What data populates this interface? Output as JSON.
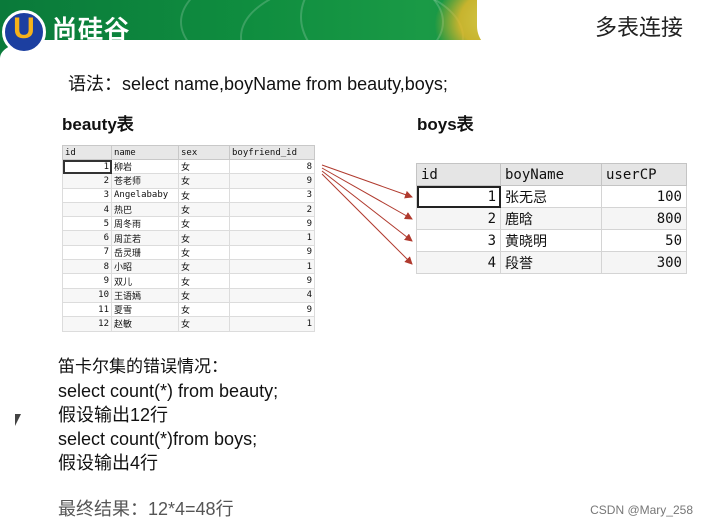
{
  "header": {
    "logo_text": "尚硅谷",
    "logo_url": "www.atguigu.com",
    "title": "多表连接"
  },
  "syntax_line": "语法：select  name,boyName from beauty,boys;",
  "beauty": {
    "label": "beauty表",
    "columns": [
      "id",
      "name",
      "sex",
      "boyfriend_id"
    ],
    "rows": [
      [
        "1",
        "柳岩",
        "女",
        "8"
      ],
      [
        "2",
        "苍老师",
        "女",
        "9"
      ],
      [
        "3",
        "Angelababy",
        "女",
        "3"
      ],
      [
        "4",
        "热巴",
        "女",
        "2"
      ],
      [
        "5",
        "周冬雨",
        "女",
        "9"
      ],
      [
        "6",
        "周芷若",
        "女",
        "1"
      ],
      [
        "7",
        "岳灵珊",
        "女",
        "9"
      ],
      [
        "8",
        "小昭",
        "女",
        "1"
      ],
      [
        "9",
        "双儿",
        "女",
        "9"
      ],
      [
        "10",
        "王语嫣",
        "女",
        "4"
      ],
      [
        "11",
        "夏雪",
        "女",
        "9"
      ],
      [
        "12",
        "赵敏",
        "女",
        "1"
      ]
    ]
  },
  "boys": {
    "label": "boys表",
    "columns": [
      "id",
      "boyName",
      "userCP"
    ],
    "rows": [
      [
        "1",
        "张无忌",
        "100"
      ],
      [
        "2",
        "鹿晗",
        "800"
      ],
      [
        "3",
        "黄晓明",
        "50"
      ],
      [
        "4",
        "段誉",
        "300"
      ]
    ]
  },
  "bottom": {
    "heading": "笛卡尔集的错误情况：",
    "line1": "select count(*) from beauty;",
    "line2": "假设输出12行",
    "line3": "select count(*)from boys;",
    "line4": "假设输出4行",
    "final": "最终结果：12*4=48行"
  },
  "watermark": "CSDN @Mary_258",
  "colors": {
    "banner_green": "#0f8d3f",
    "logo_blue": "#1c3fa0",
    "arrow": "#b03a2e"
  }
}
